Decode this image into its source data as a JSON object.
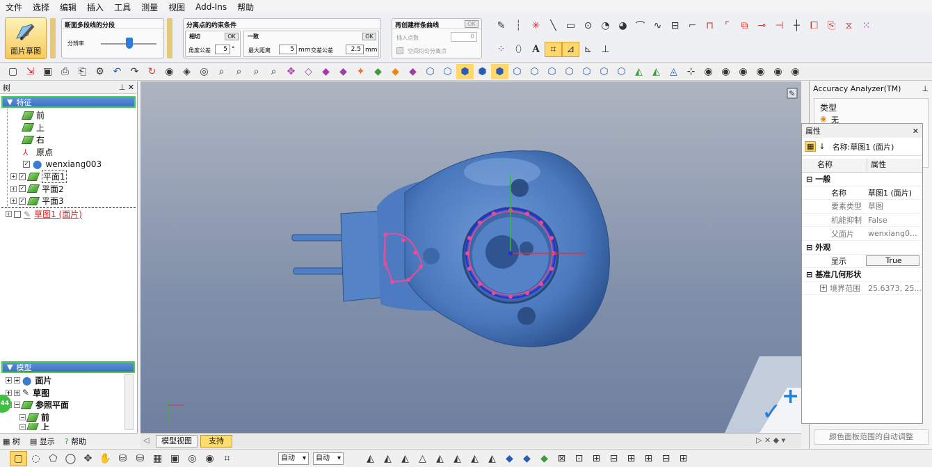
{
  "menu": [
    "文件",
    "选择",
    "编辑",
    "插入",
    "工具",
    "测量",
    "视图",
    "Add-Ins",
    "帮助"
  ],
  "ribbon": {
    "big_button_label": "面片草图",
    "segment_panel": {
      "title": "断面多段线的分段",
      "label": "分辨率"
    },
    "constraint_panel": {
      "title": "分离点的约束条件",
      "tangent_label": "相切",
      "angle_label": "角度公差",
      "angle_value": "5",
      "angle_unit": "°",
      "coincident_label": "一致",
      "max_dist_label": "最大距离",
      "max_dist_value": "5",
      "max_dist_unit": "mm",
      "intersect_label": "交差公差",
      "intersect_value": "2.5",
      "intersect_unit": "mm",
      "ok": "OK"
    },
    "spline_panel": {
      "title": "再创建样条曲线",
      "insert_label": "插入点数",
      "insert_value": "0",
      "even_label": "空间均匀分离点",
      "ok": "OK"
    }
  },
  "tree_panel": {
    "title": "树",
    "features_header": "特征",
    "features": [
      {
        "label": "前",
        "type": "plane"
      },
      {
        "label": "上",
        "type": "plane"
      },
      {
        "label": "右",
        "type": "plane"
      },
      {
        "label": "原点",
        "type": "origin"
      },
      {
        "label": "wenxiang003",
        "type": "mesh"
      },
      {
        "label": "平面1",
        "type": "plane"
      },
      {
        "label": "平面2",
        "type": "plane"
      },
      {
        "label": "平面3",
        "type": "plane"
      },
      {
        "label": "草图1 (面片)",
        "type": "sketch"
      }
    ],
    "model_header": "模型",
    "model": [
      {
        "label": "面片"
      },
      {
        "label": "草图"
      },
      {
        "label": "参照平面"
      },
      {
        "label": "前"
      },
      {
        "label": "上"
      }
    ],
    "bottom_tabs": [
      "树",
      "显示",
      "帮助"
    ],
    "badge": "44"
  },
  "viewport_tabs": [
    "模型视图",
    "支持"
  ],
  "accuracy": {
    "title": "Accuracy Analyzer(TM)",
    "type_label": "类型",
    "option_none": "无",
    "auto_adjust": "颜色面板范围的自动调整"
  },
  "properties": {
    "title": "属性",
    "name_header": "名称:草图1 (面片)",
    "col_name": "名称",
    "col_prop": "属性",
    "groups": [
      {
        "label": "一般",
        "rows": [
          {
            "k": "名称",
            "v": "草图1 (面片)"
          },
          {
            "k": "要素类型",
            "v": "草图"
          },
          {
            "k": "机能抑制",
            "v": "False"
          },
          {
            "k": "父面片",
            "v": "wenxiang0..."
          }
        ]
      },
      {
        "label": "外观",
        "rows": [
          {
            "k": "显示",
            "v": "True"
          }
        ]
      },
      {
        "label": "基准几何形状",
        "rows": [
          {
            "k": "境界范围",
            "v": "25.6373, 25..."
          }
        ]
      }
    ]
  },
  "statusbar": {
    "combo1": "自动",
    "combo2": "自动"
  },
  "colors": {
    "accent": "#f7c85a",
    "tree_header": "#4a7fd0",
    "mesh": "#4f7fc4",
    "sketch": "#e84c9a"
  }
}
